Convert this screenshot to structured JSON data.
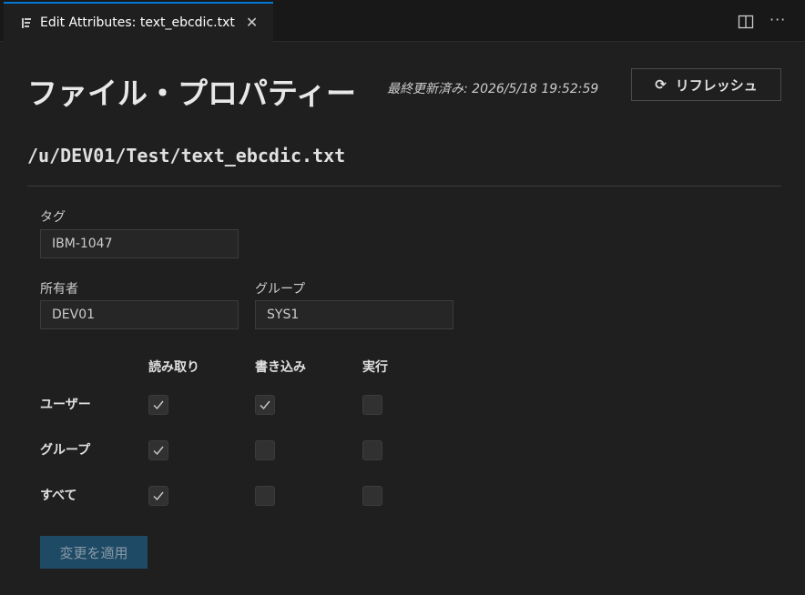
{
  "tab": {
    "title": "Edit Attributes: text_ebcdic.txt",
    "close_glyph": "✕"
  },
  "toolbar": {
    "more_glyph": "···"
  },
  "header": {
    "title": "ファイル・プロパティー",
    "last_updated": "最終更新済み: 2026/5/18 19:52:59",
    "refresh_label": "リフレッシュ",
    "refresh_glyph": "⟳"
  },
  "file": {
    "path": "/u/DEV01/Test/text_ebcdic.txt"
  },
  "fields": {
    "tag": {
      "label": "タグ",
      "value": "IBM-1047"
    },
    "owner": {
      "label": "所有者",
      "value": "DEV01"
    },
    "group": {
      "label": "グループ",
      "value": "SYS1"
    }
  },
  "permissions": {
    "columns": [
      "読み取り",
      "書き込み",
      "実行"
    ],
    "rows": [
      {
        "label": "ユーザー",
        "values": [
          true,
          true,
          false
        ]
      },
      {
        "label": "グループ",
        "values": [
          true,
          false,
          false
        ]
      },
      {
        "label": "すべて",
        "values": [
          true,
          false,
          false
        ]
      }
    ]
  },
  "apply_label": "変更を適用",
  "colors": {
    "accent": "#0078d4",
    "button_disabled": "#1e4a66",
    "background": "#1f1f1f"
  }
}
